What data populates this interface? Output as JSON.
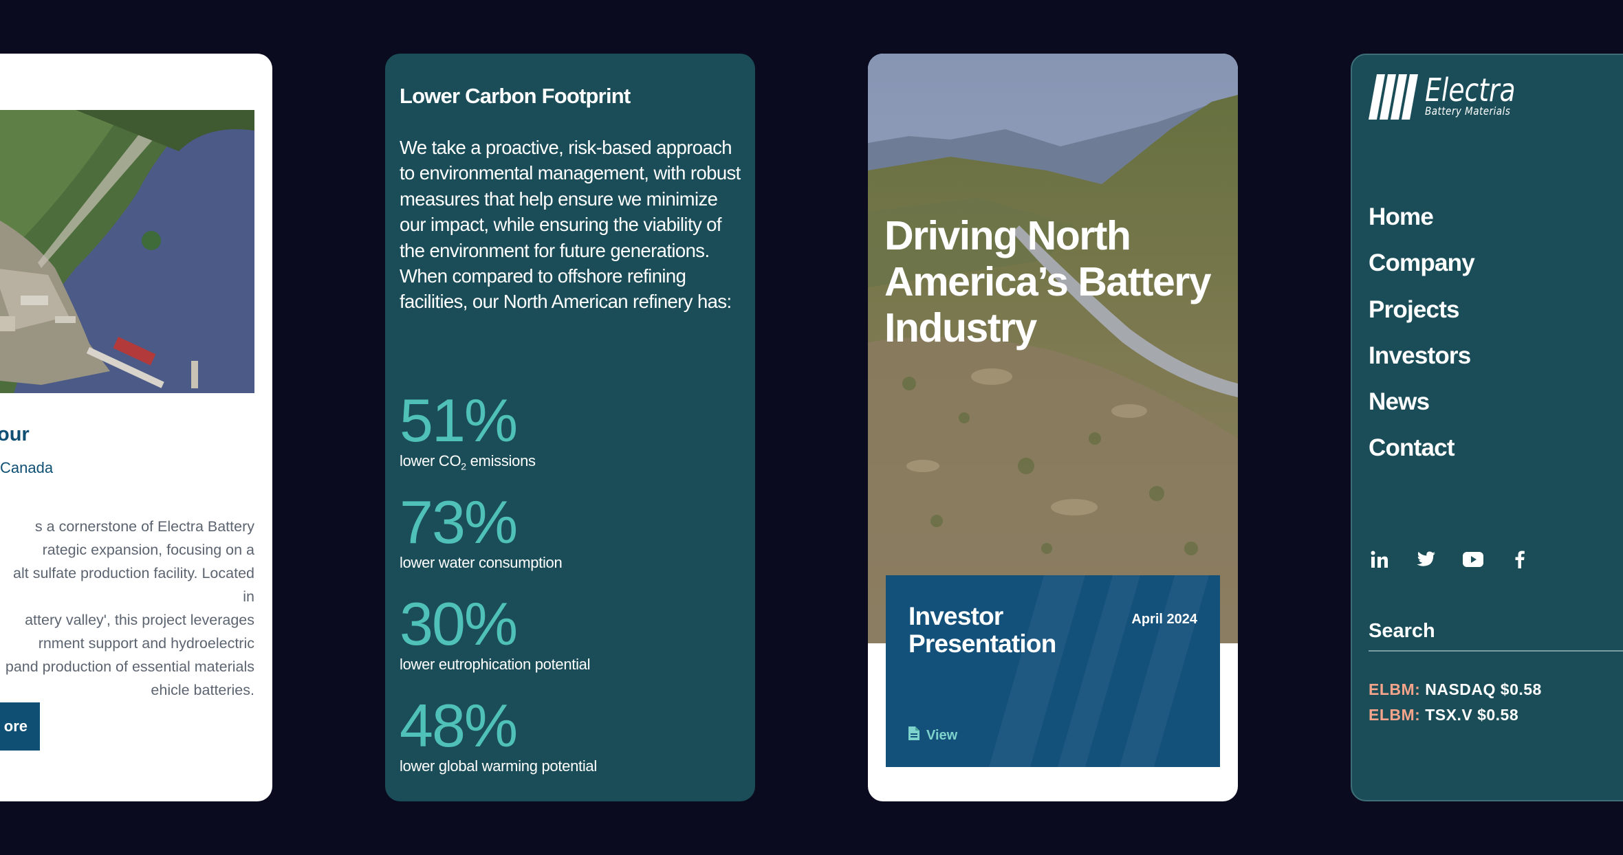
{
  "project_card": {
    "title": "our",
    "location": "Canada",
    "body": "s a cornerstone of Electra Battery\nrategic expansion, focusing on a\nalt sulfate production facility. Located in\nattery valley', this project leverages\nrnment support and hydroelectric\npand production of essential materials\nehicle batteries.",
    "button_label": "ore"
  },
  "footprint_card": {
    "heading": "Lower Carbon Footprint",
    "paragraph": "We take a proactive, risk-based approach to environmental management, with robust measures that help ensure we minimize our impact, while ensuring the viability of the environment for future generations. When compared to offshore refining facilities, our North American refinery has:",
    "stats": [
      {
        "value": "51%",
        "label_pre": "lower CO",
        "label_sub": "2",
        "label_post": " emissions"
      },
      {
        "value": "73%",
        "label": "lower water consumption"
      },
      {
        "value": "30%",
        "label": "lower eutrophication potential"
      },
      {
        "value": "48%",
        "label": "lower global warming potential"
      }
    ]
  },
  "hero_card": {
    "headline": "Driving North America’s Battery Industry",
    "investor": {
      "title": "Investor Presentation",
      "date": "April 2024",
      "view_label": "View",
      "view_icon": "file-icon"
    }
  },
  "menu_card": {
    "brand": "Electra",
    "brand_sub": "Battery Materials",
    "nav": [
      "Home",
      "Company",
      "Projects",
      "Investors",
      "News",
      "Contact"
    ],
    "social_icons": [
      "linkedin-icon",
      "twitter-icon",
      "youtube-icon",
      "facebook-icon"
    ],
    "search_label": "Search",
    "tickers": [
      {
        "symbol": "ELBM:",
        "text": "NASDAQ $0.58"
      },
      {
        "symbol": "ELBM:",
        "text": "TSX.V $0.58"
      }
    ]
  },
  "colors": {
    "background": "#0b0b1f",
    "teal_card": "#1a4d57",
    "stat_teal": "#4fc1b8",
    "navy": "#13507a",
    "ticker_symbol": "#f4a48a"
  }
}
